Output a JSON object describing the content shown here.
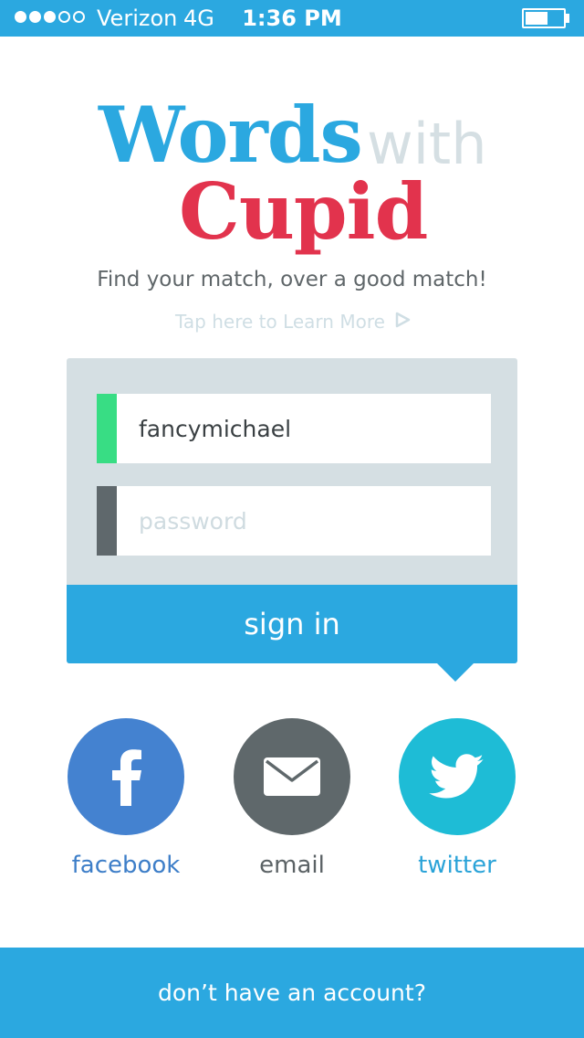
{
  "status_bar": {
    "signal_dots_total": 5,
    "signal_dots_filled": 3,
    "carrier": "Verizon",
    "network": "4G",
    "time": "1:36 PM",
    "battery_level": 0.6
  },
  "logo": {
    "word1": "Words",
    "word2": "with",
    "word3": "Cupid"
  },
  "tagline": "Find your match, over a good match!",
  "learn_more": {
    "label": "Tap here to Learn More",
    "icon": "play-outline-icon"
  },
  "login": {
    "username_value": "fancymichael",
    "password_placeholder": "password",
    "sign_in_label": "sign in"
  },
  "social": [
    {
      "label": "facebook",
      "icon": "facebook-icon"
    },
    {
      "label": "email",
      "icon": "envelope-icon"
    },
    {
      "label": "twitter",
      "icon": "twitter-bird-icon"
    }
  ],
  "footer": {
    "label": "don’t have an account?"
  },
  "colors": {
    "primary_blue": "#2ba8e0",
    "cupid_red": "#e2334d",
    "with_gray": "#d5dfe3",
    "card_bg": "#d5dfe3",
    "username_accent": "#38dd84",
    "password_accent": "#5f686c",
    "facebook": "#4482d0",
    "email": "#5f686b",
    "twitter": "#1ebcd6",
    "facebook_label": "#3d7ec8",
    "email_label": "#5b6265",
    "twitter_label": "#2aa3d8"
  }
}
